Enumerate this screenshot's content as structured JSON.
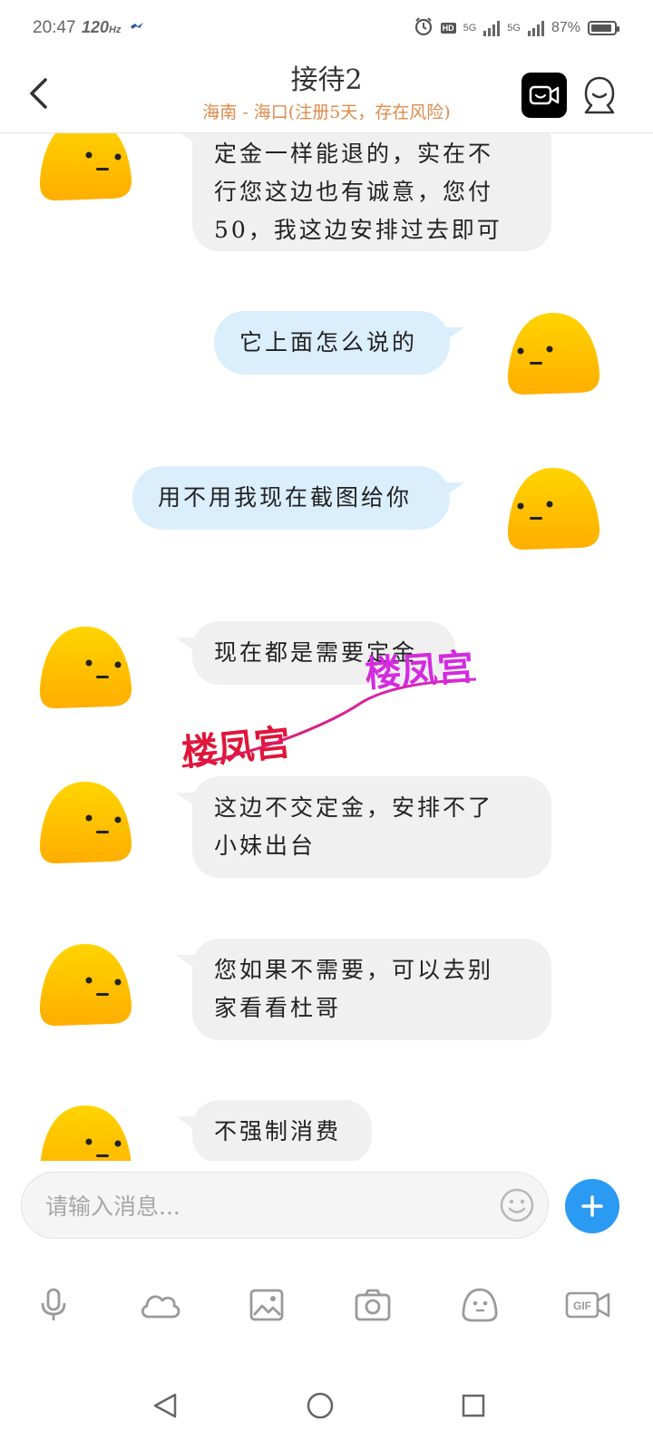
{
  "status_bar": {
    "time": "20:47",
    "refresh_rate": "120",
    "refresh_unit": "Hz",
    "hd_label": "HD",
    "network_1": "5G",
    "network_2": "5G",
    "battery": "87%"
  },
  "header": {
    "title": "接待2",
    "subtitle": "海南 - 海口(注册5天，存在风险)"
  },
  "messages": [
    {
      "side": "in",
      "text": "定金一样能退的，实在不行您这边也有诚意，您付50，我这边安排过去即可"
    },
    {
      "side": "out",
      "text": "它上面怎么说的"
    },
    {
      "side": "out",
      "text": "用不用我现在截图给你"
    },
    {
      "side": "in",
      "text": "现在都是需要定金"
    },
    {
      "side": "in",
      "text": "这边不交定金，安排不了小妹出台"
    },
    {
      "side": "in",
      "text": "您如果不需要，可以去别家看看杜哥"
    },
    {
      "side": "in",
      "text": "不强制消费"
    }
  ],
  "message_lines": {
    "m0": [
      "定金一样能退的，实在不",
      "行您这边也有诚意，您付",
      "50，我这边安排过去即可"
    ],
    "m4": [
      "这边不交定金，安排不了",
      "小妹出台"
    ],
    "m5": [
      "您如果不需要，可以去别",
      "家看看杜哥"
    ]
  },
  "watermark": {
    "text_1": "楼凤宫",
    "text_2": "楼凤宫",
    "color_1": "#e0153a",
    "color_2": "#d42ae0"
  },
  "input": {
    "placeholder": "请输入消息..."
  },
  "toolbar": [
    "microphone-icon",
    "cloud-icon",
    "image-icon",
    "camera-icon",
    "sticker-icon",
    "gif-icon"
  ],
  "toolbar_gif_label": "GIF",
  "colors": {
    "accent_blue": "#2a9af3",
    "incoming_bubble": "#f0f0f0",
    "outgoing_bubble": "#dbeefc",
    "subtitle_orange": "#e08a4a",
    "avatar_yellow": "#ffc800"
  }
}
